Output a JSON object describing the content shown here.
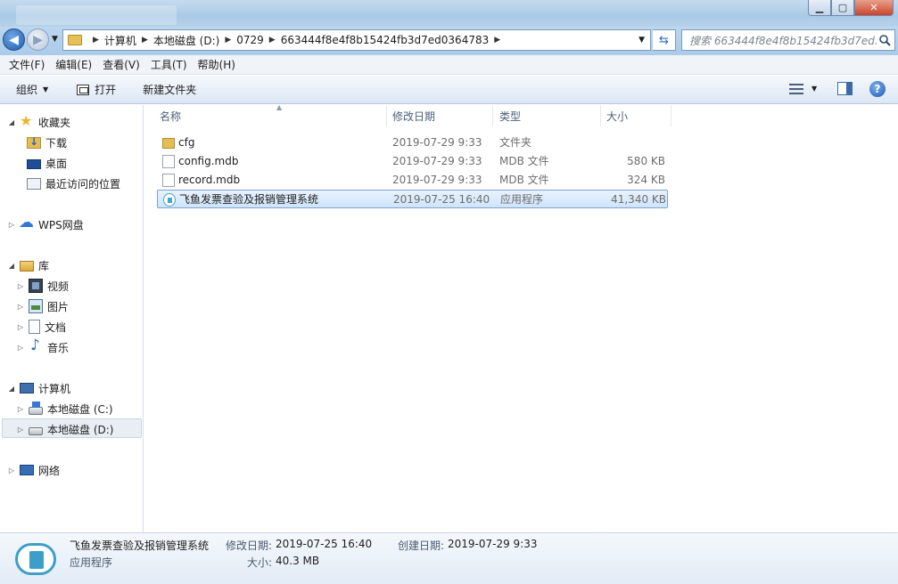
{
  "window": {
    "minimize_glyph": "▁",
    "maximize_glyph": "▢",
    "close_glyph": "✕"
  },
  "address": {
    "crumbs": [
      "计算机",
      "本地磁盘 (D:)",
      "0729",
      "663444f8e4f8b15424fb3d7ed0364783"
    ],
    "search_placeholder": "搜索 663444f8e4f8b15424fb3d7ed..."
  },
  "menu": [
    "文件(F)",
    "编辑(E)",
    "查看(V)",
    "工具(T)",
    "帮助(H)"
  ],
  "toolbar": {
    "organize": "组织",
    "open": "打开",
    "new_folder": "新建文件夹",
    "help_glyph": "?"
  },
  "nav": {
    "favorites": "收藏夹",
    "downloads": "下载",
    "desktop": "桌面",
    "recent": "最近访问的位置",
    "wps": "WPS网盘",
    "libraries": "库",
    "videos": "视频",
    "pictures": "图片",
    "documents": "文档",
    "music": "音乐",
    "computer": "计算机",
    "drive_c": "本地磁盘 (C:)",
    "drive_d": "本地磁盘 (D:)",
    "network": "网络"
  },
  "columns": {
    "name": "名称",
    "date": "修改日期",
    "type": "类型",
    "size": "大小"
  },
  "files": [
    {
      "name": "cfg",
      "date": "2019-07-29 9:33",
      "type": "文件夹",
      "size": "",
      "icon": "folder-icon"
    },
    {
      "name": "config.mdb",
      "date": "2019-07-29 9:33",
      "type": "MDB 文件",
      "size": "580 KB",
      "icon": "file-icon"
    },
    {
      "name": "record.mdb",
      "date": "2019-07-29 9:33",
      "type": "MDB 文件",
      "size": "324 KB",
      "icon": "file-icon"
    },
    {
      "name": "飞鱼发票查验及报销管理系统",
      "date": "2019-07-25 16:40",
      "type": "应用程序",
      "size": "41,340 KB",
      "icon": "app-icon",
      "selected": true
    }
  ],
  "details": {
    "name": "飞鱼发票查验及报销管理系统",
    "type": "应用程序",
    "modified_label": "修改日期:",
    "modified": "2019-07-25 16:40",
    "created_label": "创建日期:",
    "created": "2019-07-29 9:33",
    "size_label": "大小:",
    "size": "40.3 MB"
  }
}
